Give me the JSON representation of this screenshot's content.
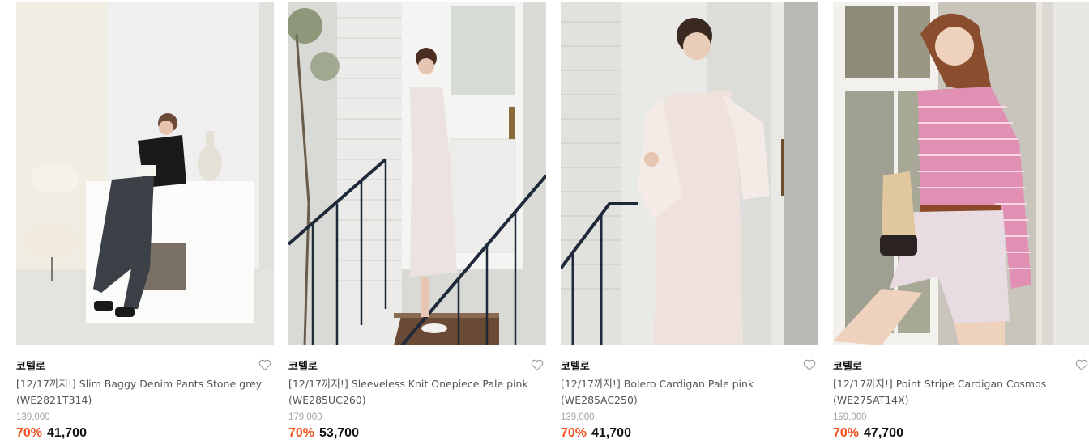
{
  "colors": {
    "discount": "#f4511e",
    "original_price": "#a3a3a3",
    "brand": "#111111"
  },
  "products": [
    {
      "brand": "코텔로",
      "title": "[12/17까지!] Slim Baggy Denim Pants Stone grey (WE2821T314)",
      "original_price": "139,000",
      "discount": "70%",
      "price": "41,700",
      "wishlist_icon": "heart-outline-icon"
    },
    {
      "brand": "코텔로",
      "title": "[12/17까지!] Sleeveless Knit Onepiece Pale pink (WE285UC260)",
      "original_price": "179,000",
      "discount": "70%",
      "price": "53,700",
      "wishlist_icon": "heart-outline-icon"
    },
    {
      "brand": "코텔로",
      "title": "[12/17까지!] Bolero Cardigan Pale pink (WE285AC250)",
      "original_price": "139,000",
      "discount": "70%",
      "price": "41,700",
      "wishlist_icon": "heart-outline-icon"
    },
    {
      "brand": "코텔로",
      "title": "[12/17까지!] Point Stripe Cardigan Cosmos (WE275AT14X)",
      "original_price": "159,000",
      "discount": "70%",
      "price": "47,700",
      "wishlist_icon": "heart-outline-icon"
    }
  ]
}
